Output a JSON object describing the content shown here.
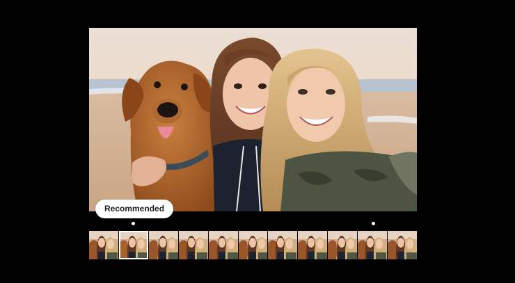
{
  "badge": {
    "label": "Recommended"
  },
  "filmstrip": {
    "frame_count": 11,
    "selected_index": 1
  },
  "colors": {
    "background": "#000000",
    "badge_bg": "#ffffff",
    "badge_text": "#1f1f1f",
    "selection_border": "#ffffff"
  }
}
